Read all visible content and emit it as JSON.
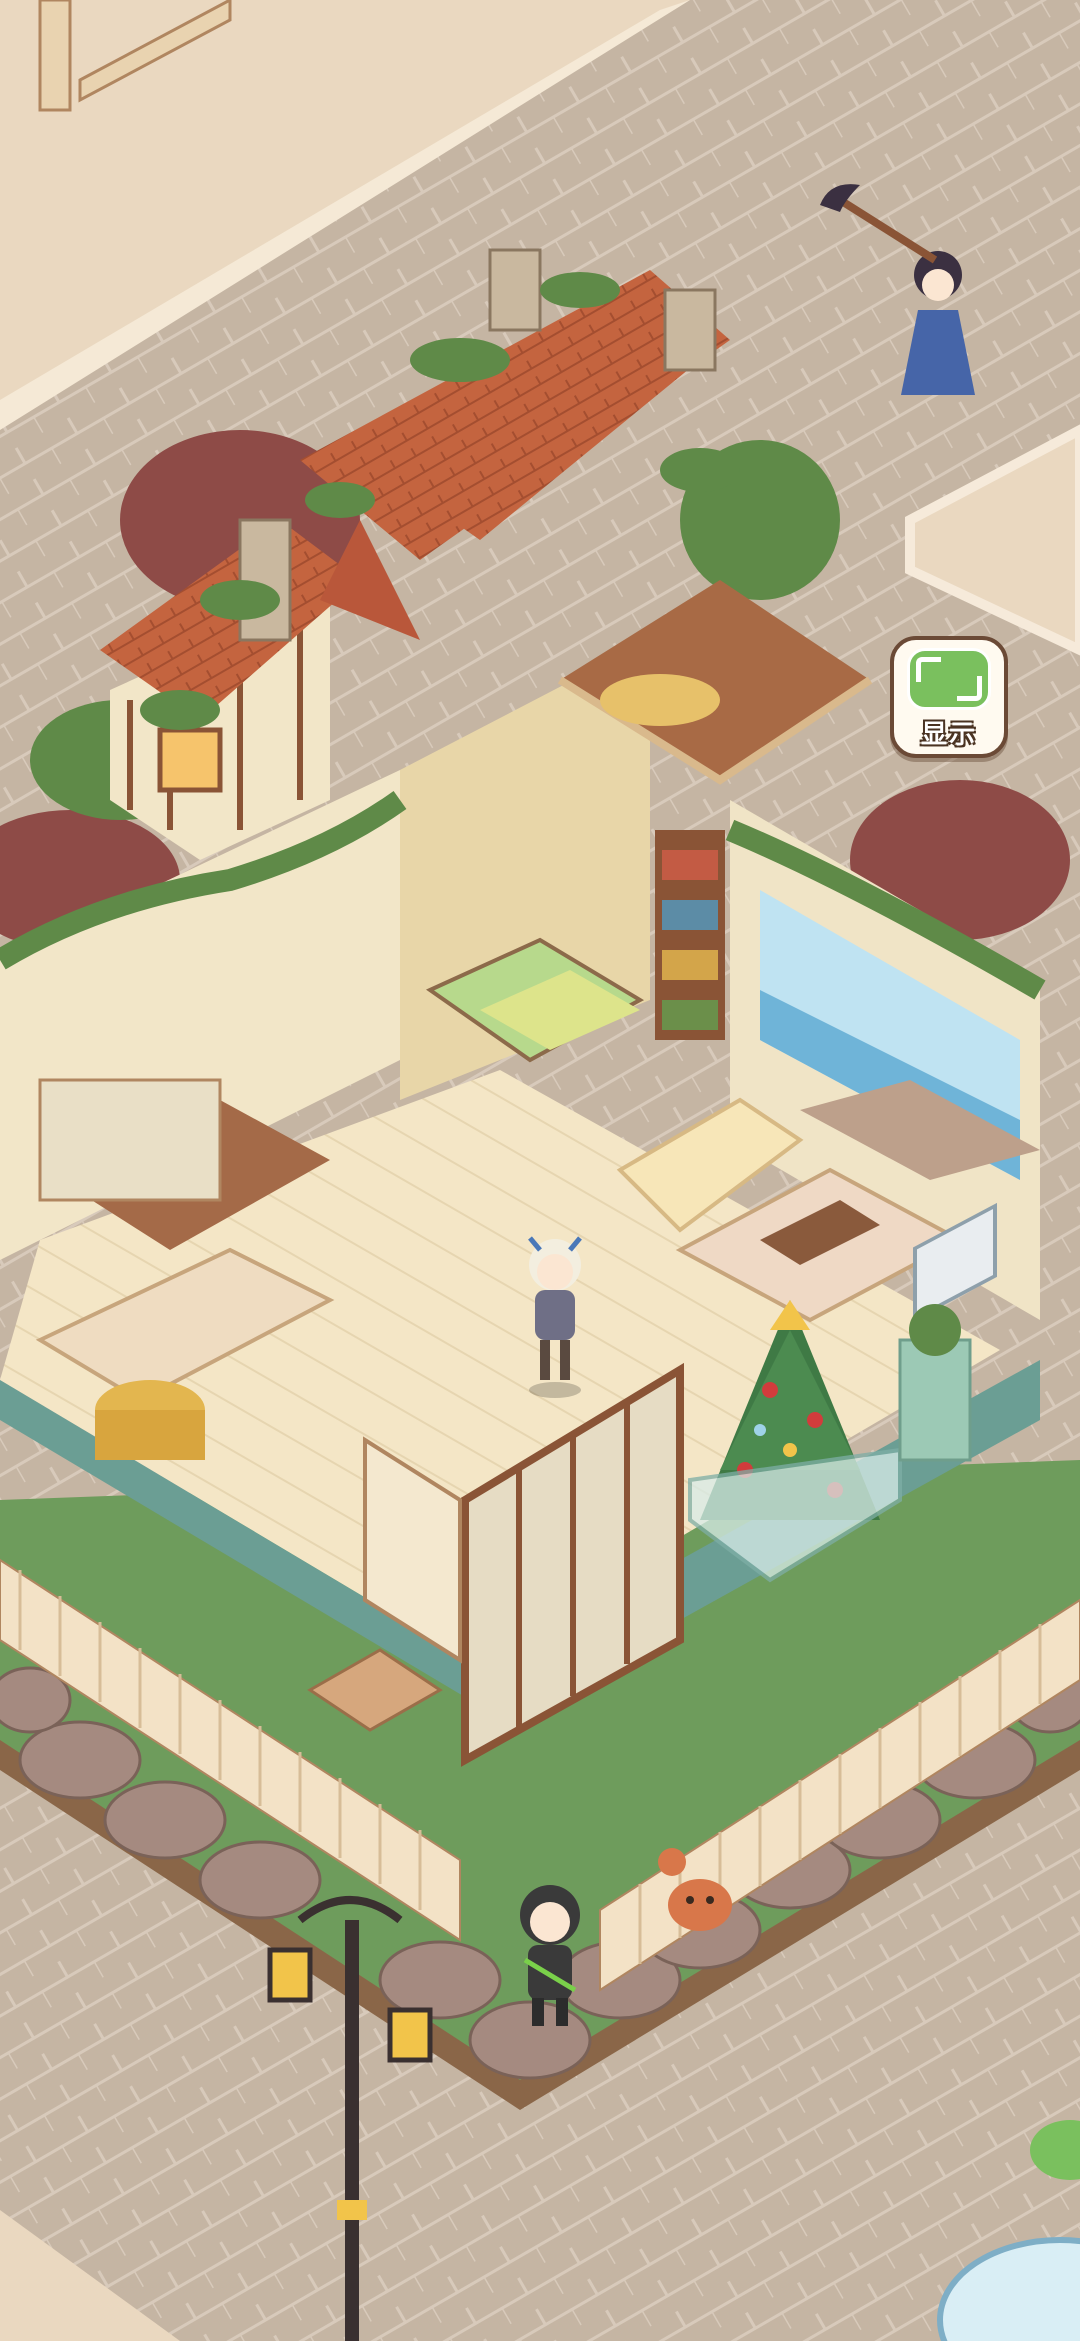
{
  "toolbar": {
    "display_button": {
      "label": "显示",
      "icon": "green-frame-icon"
    }
  },
  "colors": {
    "pavement": "#c6b6a4",
    "grass": "#6c9a5a",
    "wall": "#f2e6c8",
    "roof": "#c0633f",
    "floor": "#f3e5c4",
    "accent_green": "#7ac05e"
  }
}
